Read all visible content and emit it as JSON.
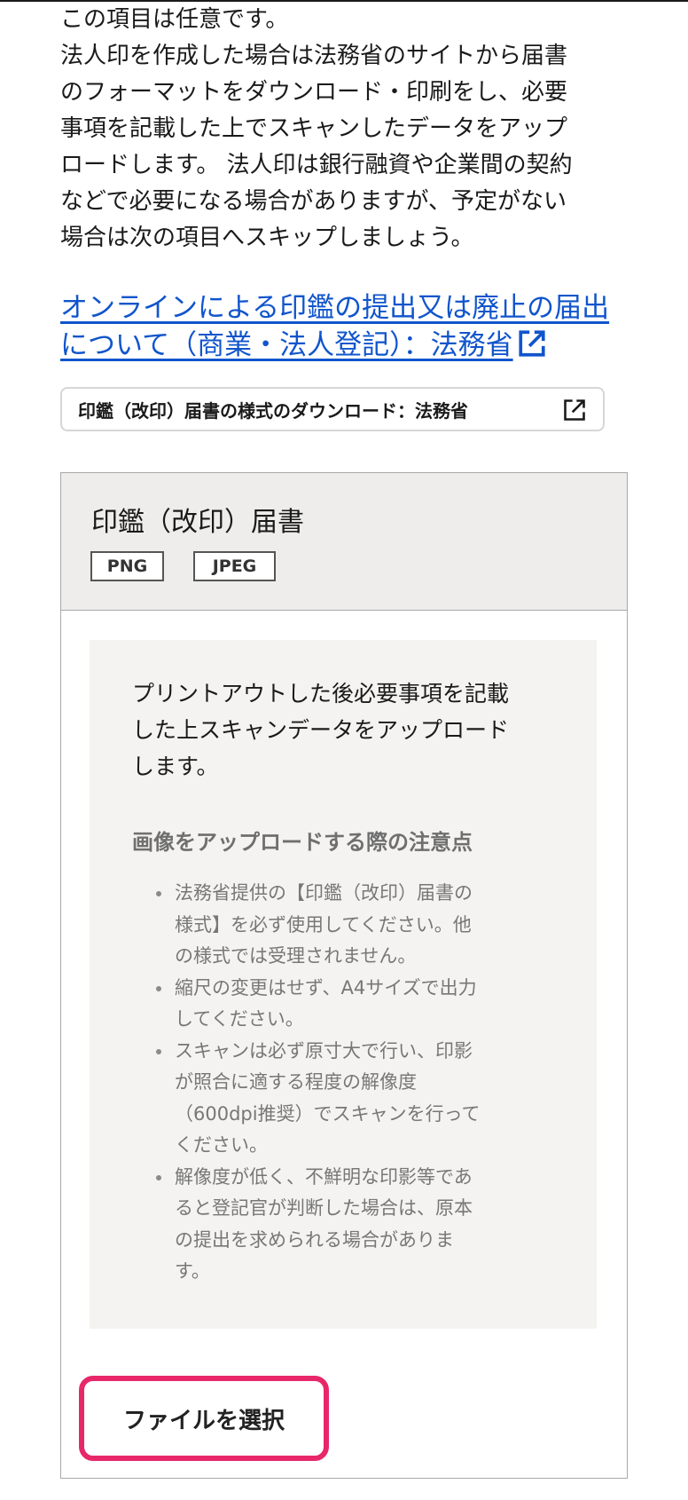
{
  "intro": {
    "text": "この項目は任意です。\n法人印を作成した場合は法務省のサイトから届書\nのフォーマットをダウンロード・印刷をし、必要\n事項を記載した上でスキャンしたデータをアップ\nロードします。 法人印は銀行融資や企業間の契約\nなどで必要になる場合がありますが、予定がない\n場合は次の項目へスキップしましょう。"
  },
  "link": {
    "text": "オンラインによる印鑑の提出又は廃止の届出について（商業・法人登記）：法務省",
    "icon": "external-link-icon"
  },
  "download_button": {
    "label": "印鑑（改印）届書の様式のダウンロード：法務省",
    "icon": "external-link-icon"
  },
  "card": {
    "title": "印鑑（改印）届書",
    "badges": [
      "PNG",
      "JPEG"
    ],
    "description": "プリントアウトした後必要事項を記載\nした上スキャンデータをアップロード\nします。",
    "caution_title": "画像をアップロードする際の注意点",
    "cautions": [
      "法務省提供の【印鑑（改印）届書の\n様式】を必ず使用してください。他\nの様式では受理されません。",
      "縮尺の変更はせず、A4サイズで出力\nしてください。",
      "スキャンは必ず原寸大で行い、印影\nが照合に適する程度の解像度\n（600dpi推奨）でスキャンを行って\nください。",
      "解像度が低く、不鮮明な印影等であ\nると登記官が判断した場合は、原本\nの提出を求められる場合がありま\nす。"
    ],
    "file_button_label": "ファイルを選択"
  },
  "colors": {
    "link": "#1155cc",
    "highlight": "#e8276a",
    "header_bg": "#eeedeb",
    "info_bg": "#f4f3f1"
  }
}
